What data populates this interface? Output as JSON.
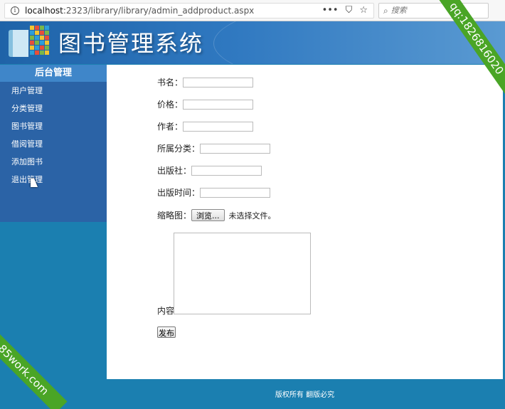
{
  "browser": {
    "url_host": "localhost",
    "url_rest": ":2323/library/library/admin_addproduct.aspx",
    "search_placeholder": "搜索",
    "tools": [
      "•••",
      "⛉",
      "☆"
    ]
  },
  "banner": {
    "title": "图书管理系统"
  },
  "sidebar": {
    "header": "后台管理",
    "items": [
      {
        "label": "用户管理"
      },
      {
        "label": "分类管理"
      },
      {
        "label": "图书管理"
      },
      {
        "label": "借阅管理"
      },
      {
        "label": "添加图书"
      },
      {
        "label": "退出管理"
      }
    ]
  },
  "form": {
    "title_label": "书名：",
    "price_label": "价格：",
    "author_label": "作者：",
    "category_label": "所属分类：",
    "publisher_label": "出版社：",
    "publish_time_label": "出版时间：",
    "thumbnail_label": "缩略图：",
    "browse_button": "浏览...",
    "file_status": "未选择文件。",
    "content_label": "内容",
    "submit_button": "发布"
  },
  "footer": {
    "text": "版权所有 翻版必究"
  },
  "watermarks": {
    "top_right": "qq:1826816020",
    "bottom_left": "85work.com"
  },
  "colors": {
    "page_background": "#1b7fb0",
    "banner": "#2f78c0",
    "sidebar": "#2b63a6",
    "sidebar_header": "#3f86c9",
    "ribbon": "#4aa526"
  }
}
